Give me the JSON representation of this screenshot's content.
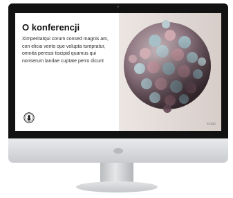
{
  "slide": {
    "title": "O konferencji",
    "body": "Ximperitatqui corum consed magnis am, con elicia vento que volupta turepratur, omnita peressi tiscipid quamus qui nonserum landae cuptate perro dicunt",
    "image_credit": "© CDC"
  },
  "icons": {
    "emblem": "university-emblem-icon",
    "virus": "virus-illustration"
  },
  "colors": {
    "bezel": "#121212",
    "screen_background": "#ffffff",
    "image_background": "#e2dad6"
  }
}
